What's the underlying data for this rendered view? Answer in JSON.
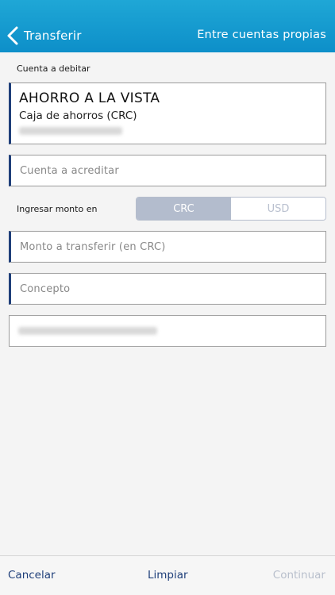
{
  "header": {
    "back_label": "Transferir",
    "right_title": "Entre cuentas propias"
  },
  "debit": {
    "section_label": "Cuenta a debitar",
    "account_name": "AHORRO A LA VISTA",
    "account_type": "Caja de ahorros (CRC)"
  },
  "credit_account": {
    "placeholder": "Cuenta a acreditar"
  },
  "amount_currency": {
    "label": "Ingresar monto en",
    "options": [
      "CRC",
      "USD"
    ],
    "selected": "CRC"
  },
  "amount": {
    "placeholder": "Monto a transferir (en CRC)"
  },
  "concept": {
    "placeholder": "Concepto"
  },
  "footer": {
    "cancel": "Cancelar",
    "clear": "Limpiar",
    "continue": "Continuar"
  },
  "colors": {
    "header_blue": "#0d8fc9",
    "accent_navy": "#1f3f7a",
    "segment_active": "#b3bccd",
    "disabled_text": "#b8bfcc"
  }
}
